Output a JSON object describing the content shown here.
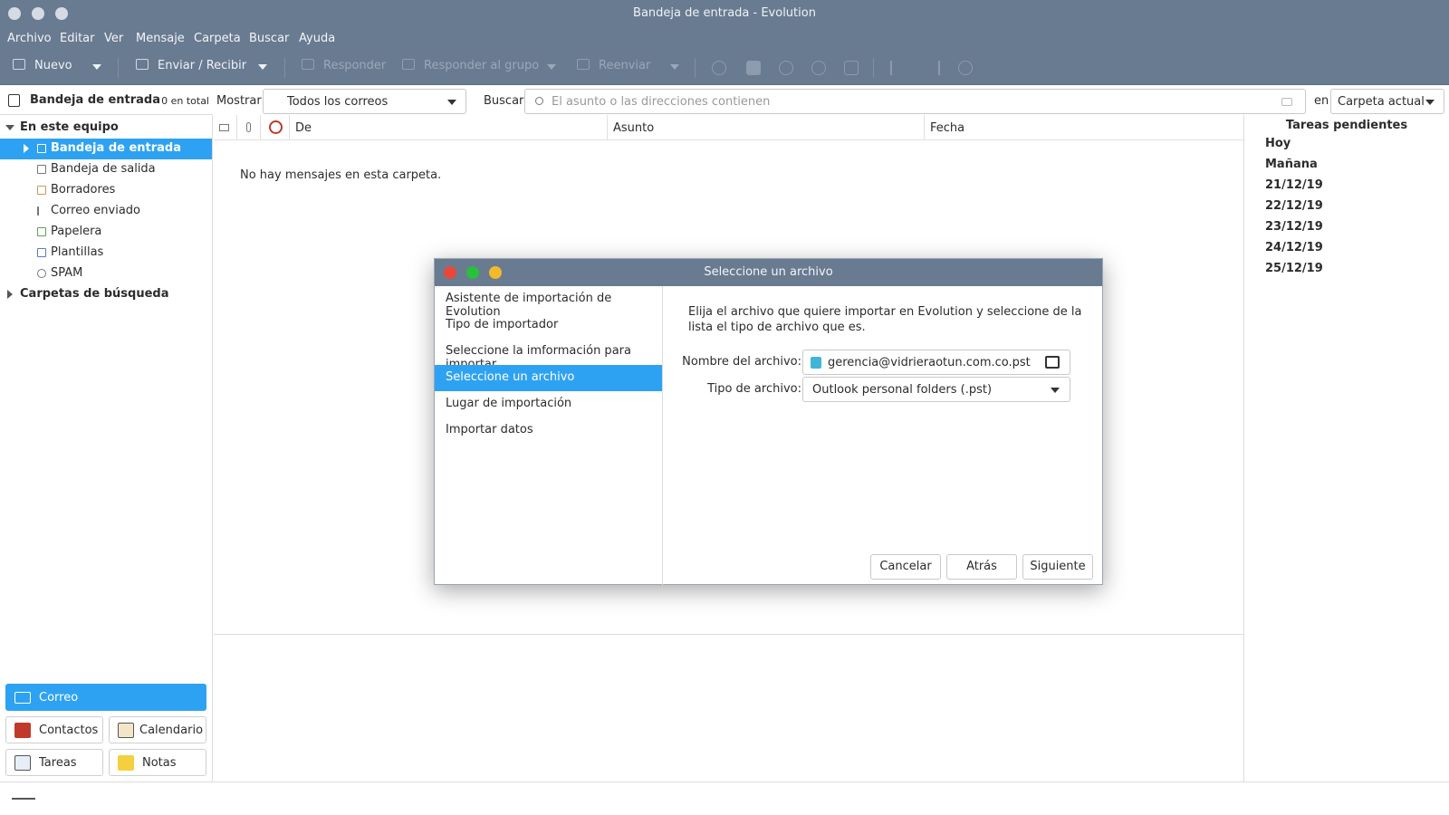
{
  "window": {
    "title": "Bandeja de entrada - Evolution"
  },
  "menu": [
    "Archivo",
    "Editar",
    "Ver",
    "Mensaje",
    "Carpeta",
    "Buscar",
    "Ayuda"
  ],
  "toolbar": {
    "new_label": "Nuevo",
    "send_receive_label": "Enviar / Recibir",
    "reply_label": "Responder",
    "reply_group_label": "Responder al grupo",
    "forward_label": "Reenviar"
  },
  "folder_header": {
    "name": "Bandeja de entrada",
    "count": "0 en total"
  },
  "filter": {
    "show_label": "Mostrar:",
    "show_value": "Todos los correos",
    "search_label": "Buscar:",
    "search_placeholder": "El asunto o las direcciones contienen",
    "in_label": "en",
    "scope_value": "Carpeta actual"
  },
  "folders": {
    "group_label": "En este equipo",
    "items": [
      "Bandeja de entrada",
      "Bandeja de salida",
      "Borradores",
      "Correo enviado",
      "Papelera",
      "Plantillas",
      "SPAM"
    ],
    "search_folders_label": "Carpetas de búsqueda"
  },
  "switcher": {
    "mail": "Correo",
    "contacts": "Contactos",
    "calendar": "Calendario",
    "tasks": "Tareas",
    "notes": "Notas"
  },
  "message_list": {
    "columns": {
      "from": "De",
      "subject": "Asunto",
      "date": "Fecha"
    },
    "empty_text": "No hay mensajes en esta carpeta."
  },
  "tasks_panel": {
    "title": "Tareas pendientes",
    "days": [
      "Hoy",
      "Mañana",
      "21/12/19",
      "22/12/19",
      "23/12/19",
      "24/12/19",
      "25/12/19"
    ]
  },
  "dialog": {
    "title": "Seleccione un archivo",
    "steps": [
      "Asistente de importación de Evolution",
      "Tipo de importador",
      "Seleccione la imformación para importar",
      "Seleccione un archivo",
      "Lugar de importación",
      "Importar datos"
    ],
    "intro": "Elija el archivo que quiere importar en Evolution y seleccione de la lista el tipo de archivo que es.",
    "file_name_label": "Nombre del archivo:",
    "file_name_value": "gerencia@vidrieraotun.com.co.pst",
    "file_type_label": "Tipo de archivo:",
    "file_type_value": "Outlook personal folders (.pst)",
    "cancel_label": "Cancelar",
    "back_label": "Atrás",
    "next_label": "Siguiente"
  },
  "colors": {
    "titlebar": "#697b91",
    "accent": "#2ea2f2",
    "close": "#e8473b",
    "maximize": "#27c13a",
    "minimize": "#f5b92b"
  }
}
